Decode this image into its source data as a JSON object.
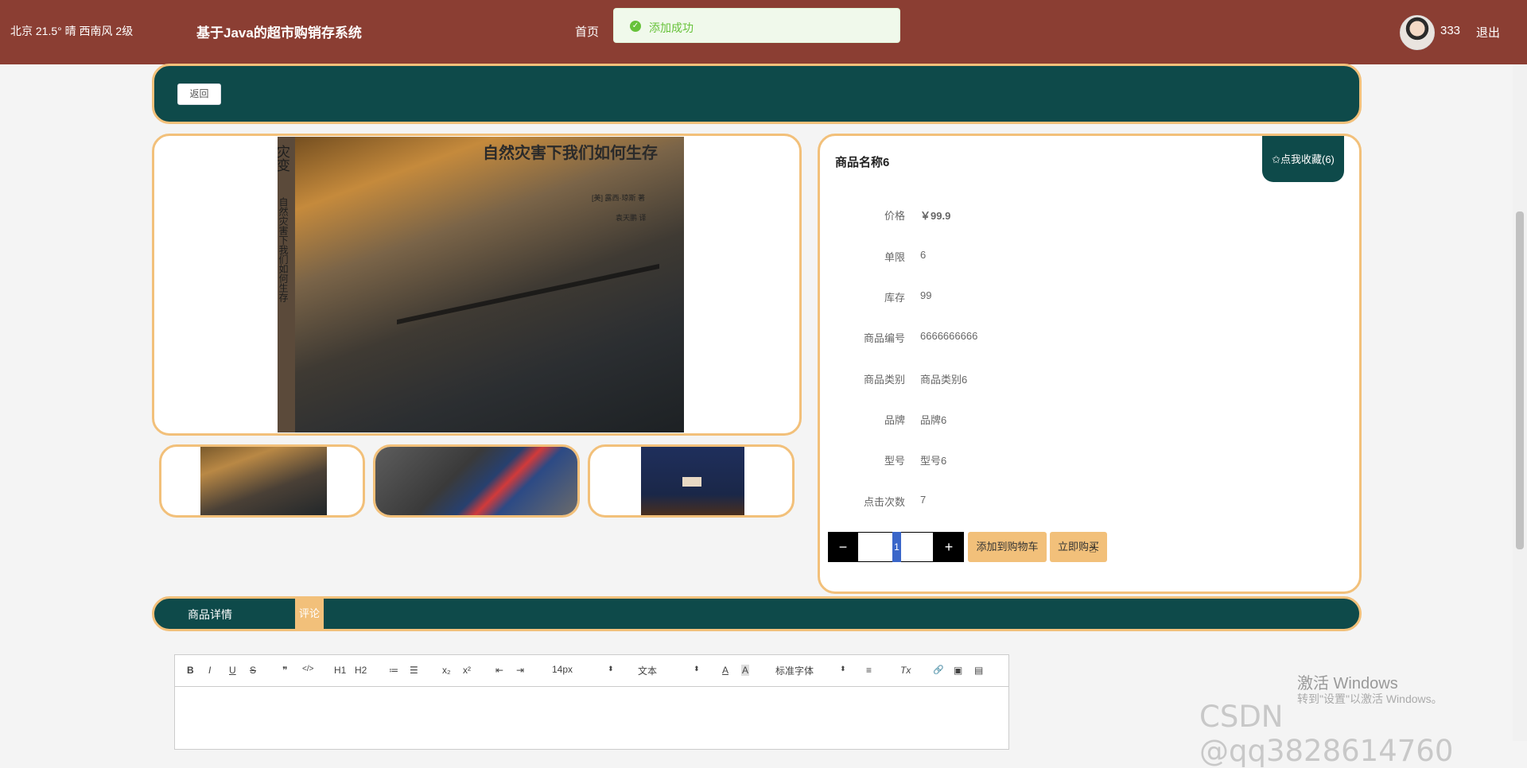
{
  "header": {
    "weather": "北京  21.5°  晴  西南风  2级",
    "title": "基于Java的超市购销存系统",
    "nav_home": "首页",
    "username": "333",
    "logout": "退出"
  },
  "toast": {
    "icon": "check-circle-icon",
    "text": "添加成功"
  },
  "back_label": "返回",
  "book_cover": {
    "title": "自然灾害下我们如何生存",
    "spine_title": "灾变",
    "spine_subtitle": "自然灾害下我们如何生存",
    "author_line": "[美] 露西·琼斯 著",
    "translator_line": "袁天鹏 译"
  },
  "product": {
    "name": "商品名称6",
    "favorite_label": "✩点我收藏(6)",
    "fields": [
      {
        "label": "价格",
        "value": "￥99.9"
      },
      {
        "label": "单限",
        "value": "6"
      },
      {
        "label": "库存",
        "value": "99"
      },
      {
        "label": "商品编号",
        "value": "6666666666"
      },
      {
        "label": "商品类别",
        "value": "商品类别6"
      },
      {
        "label": "品牌",
        "value": "品牌6"
      },
      {
        "label": "型号",
        "value": "型号6"
      },
      {
        "label": "点击次数",
        "value": "7"
      }
    ],
    "quantity": "1",
    "minus": "−",
    "plus": "+",
    "add_to_cart": "添加到购物车",
    "buy_now": "立即购买"
  },
  "tabs": {
    "detail": "商品详情",
    "comment": "评论"
  },
  "editor": {
    "font_size": "14px",
    "header_select": "文本",
    "font_family": "标准字体",
    "tools": [
      "B",
      "I",
      "U",
      "S",
      "❞",
      "</>",
      "H1",
      "H2",
      "≔",
      "☰",
      "x₂",
      "x²",
      "⇤",
      "⇥",
      "A",
      "A",
      "≡",
      "Tx",
      "🔗",
      "▣",
      "▤"
    ]
  },
  "watermark": {
    "line1": "激活 Windows",
    "line2": "转到\"设置\"以激活 Windows。",
    "csdn": "CSDN @qq3828614760"
  },
  "colors": {
    "header": "#8b3e33",
    "teal": "#0e4a4a",
    "accent": "#f2c07a",
    "success": "#67c23a"
  }
}
